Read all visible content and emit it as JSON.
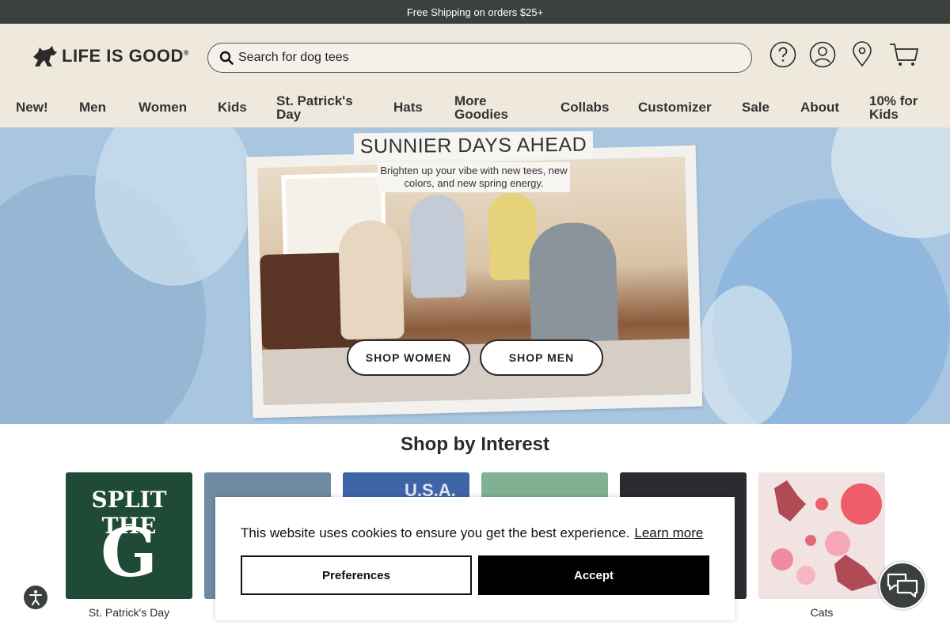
{
  "promo": {
    "text": "Free Shipping on orders $25+"
  },
  "header": {
    "logo_text": "LIFE IS GOOD",
    "logo_mark": "®",
    "search_placeholder": "Search for dog tees",
    "icons": [
      "help-icon",
      "account-icon",
      "store-locator-icon",
      "cart-icon"
    ]
  },
  "nav": {
    "items": [
      {
        "label": "New!"
      },
      {
        "label": "Men"
      },
      {
        "label": "Women"
      },
      {
        "label": "Kids"
      },
      {
        "label": "St. Patrick's Day"
      },
      {
        "label": "Hats"
      },
      {
        "label": "More Goodies"
      },
      {
        "label": "Collabs"
      },
      {
        "label": "Customizer"
      },
      {
        "label": "Sale"
      },
      {
        "label": "About"
      },
      {
        "label": "10% for Kids"
      }
    ]
  },
  "hero": {
    "title": "SUNNIER DAYS AHEAD",
    "subtitle": "Brighten up your vibe with new tees, new colors, and new spring energy.",
    "buttons": {
      "women": "SHOP WOMEN",
      "men": "SHOP MEN"
    }
  },
  "interests": {
    "title": "Shop by Interest",
    "tiles": [
      {
        "label": "St. Patrick's Day",
        "art_text_top": "SPLIT THE",
        "art_text_big": "G",
        "bg": "#1f4a36"
      },
      {
        "label": "",
        "bg": "#6f8aa3"
      },
      {
        "label": "",
        "art_text_top": "U.S.A.",
        "bg": "#3e64a8"
      },
      {
        "label": "",
        "bg": "#7fb192"
      },
      {
        "label": "",
        "bg": "#2a2a30"
      },
      {
        "label": "Cats",
        "bg": "#f2e3e3"
      }
    ]
  },
  "cookie": {
    "message": "This website uses cookies to ensure you get the best experience.",
    "link": "Learn more",
    "preferences": "Preferences",
    "accept": "Accept"
  },
  "widgets": {
    "accessibility": "accessibility-icon",
    "chat": "chat-icon"
  },
  "colors": {
    "header_bg": "#efe9dd",
    "promo_bg": "#3b403f",
    "hero_bg": "#a9c6e1",
    "accept_bg": "#000000"
  }
}
